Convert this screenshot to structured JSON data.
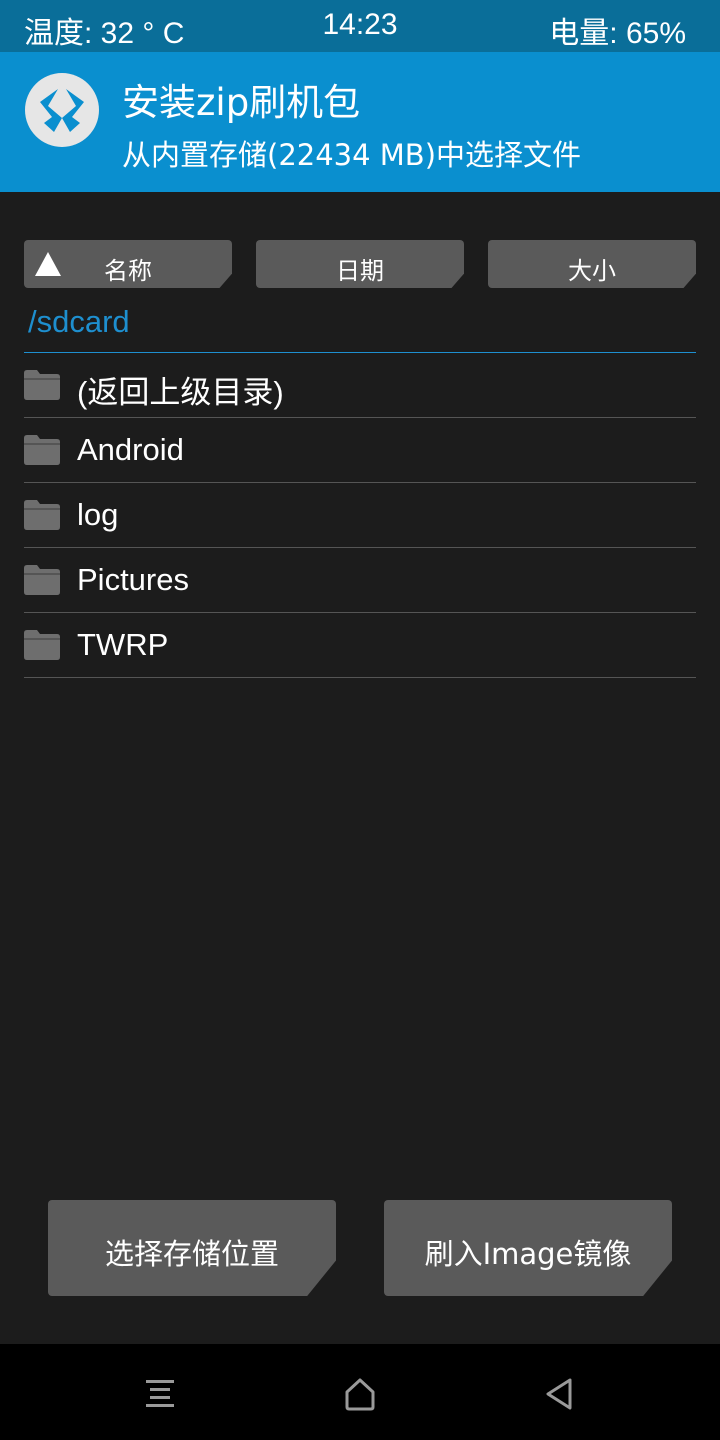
{
  "status_bar": {
    "temperature": "温度: 32 ° C",
    "time": "14:23",
    "battery": "电量: 65%"
  },
  "header": {
    "logo_icon": "twrp-logo-icon",
    "title": "安装zip刷机包",
    "subtitle": "从内置存储(22434 MB)中选择文件"
  },
  "sort_buttons": {
    "name": "名称",
    "date": "日期",
    "size": "大小",
    "active_icon": "sort-ascending-icon"
  },
  "path": "/sdcard",
  "files": [
    {
      "name": "(返回上级目录)",
      "icon": "folder-icon"
    },
    {
      "name": "Android",
      "icon": "folder-icon"
    },
    {
      "name": "log",
      "icon": "folder-icon"
    },
    {
      "name": "Pictures",
      "icon": "folder-icon"
    },
    {
      "name": "TWRP",
      "icon": "folder-icon"
    }
  ],
  "actions": {
    "select_storage": "选择存储位置",
    "flash_image": "刷入Image镜像"
  },
  "nav_bar": {
    "menu_icon": "menu-icon",
    "home_icon": "home-icon",
    "back_icon": "back-icon"
  },
  "colors": {
    "status_bar": "#0a6e99",
    "header": "#0a8fcf",
    "accent": "#1e8fcf",
    "background": "#1c1c1c",
    "button": "#5a5a5a"
  }
}
